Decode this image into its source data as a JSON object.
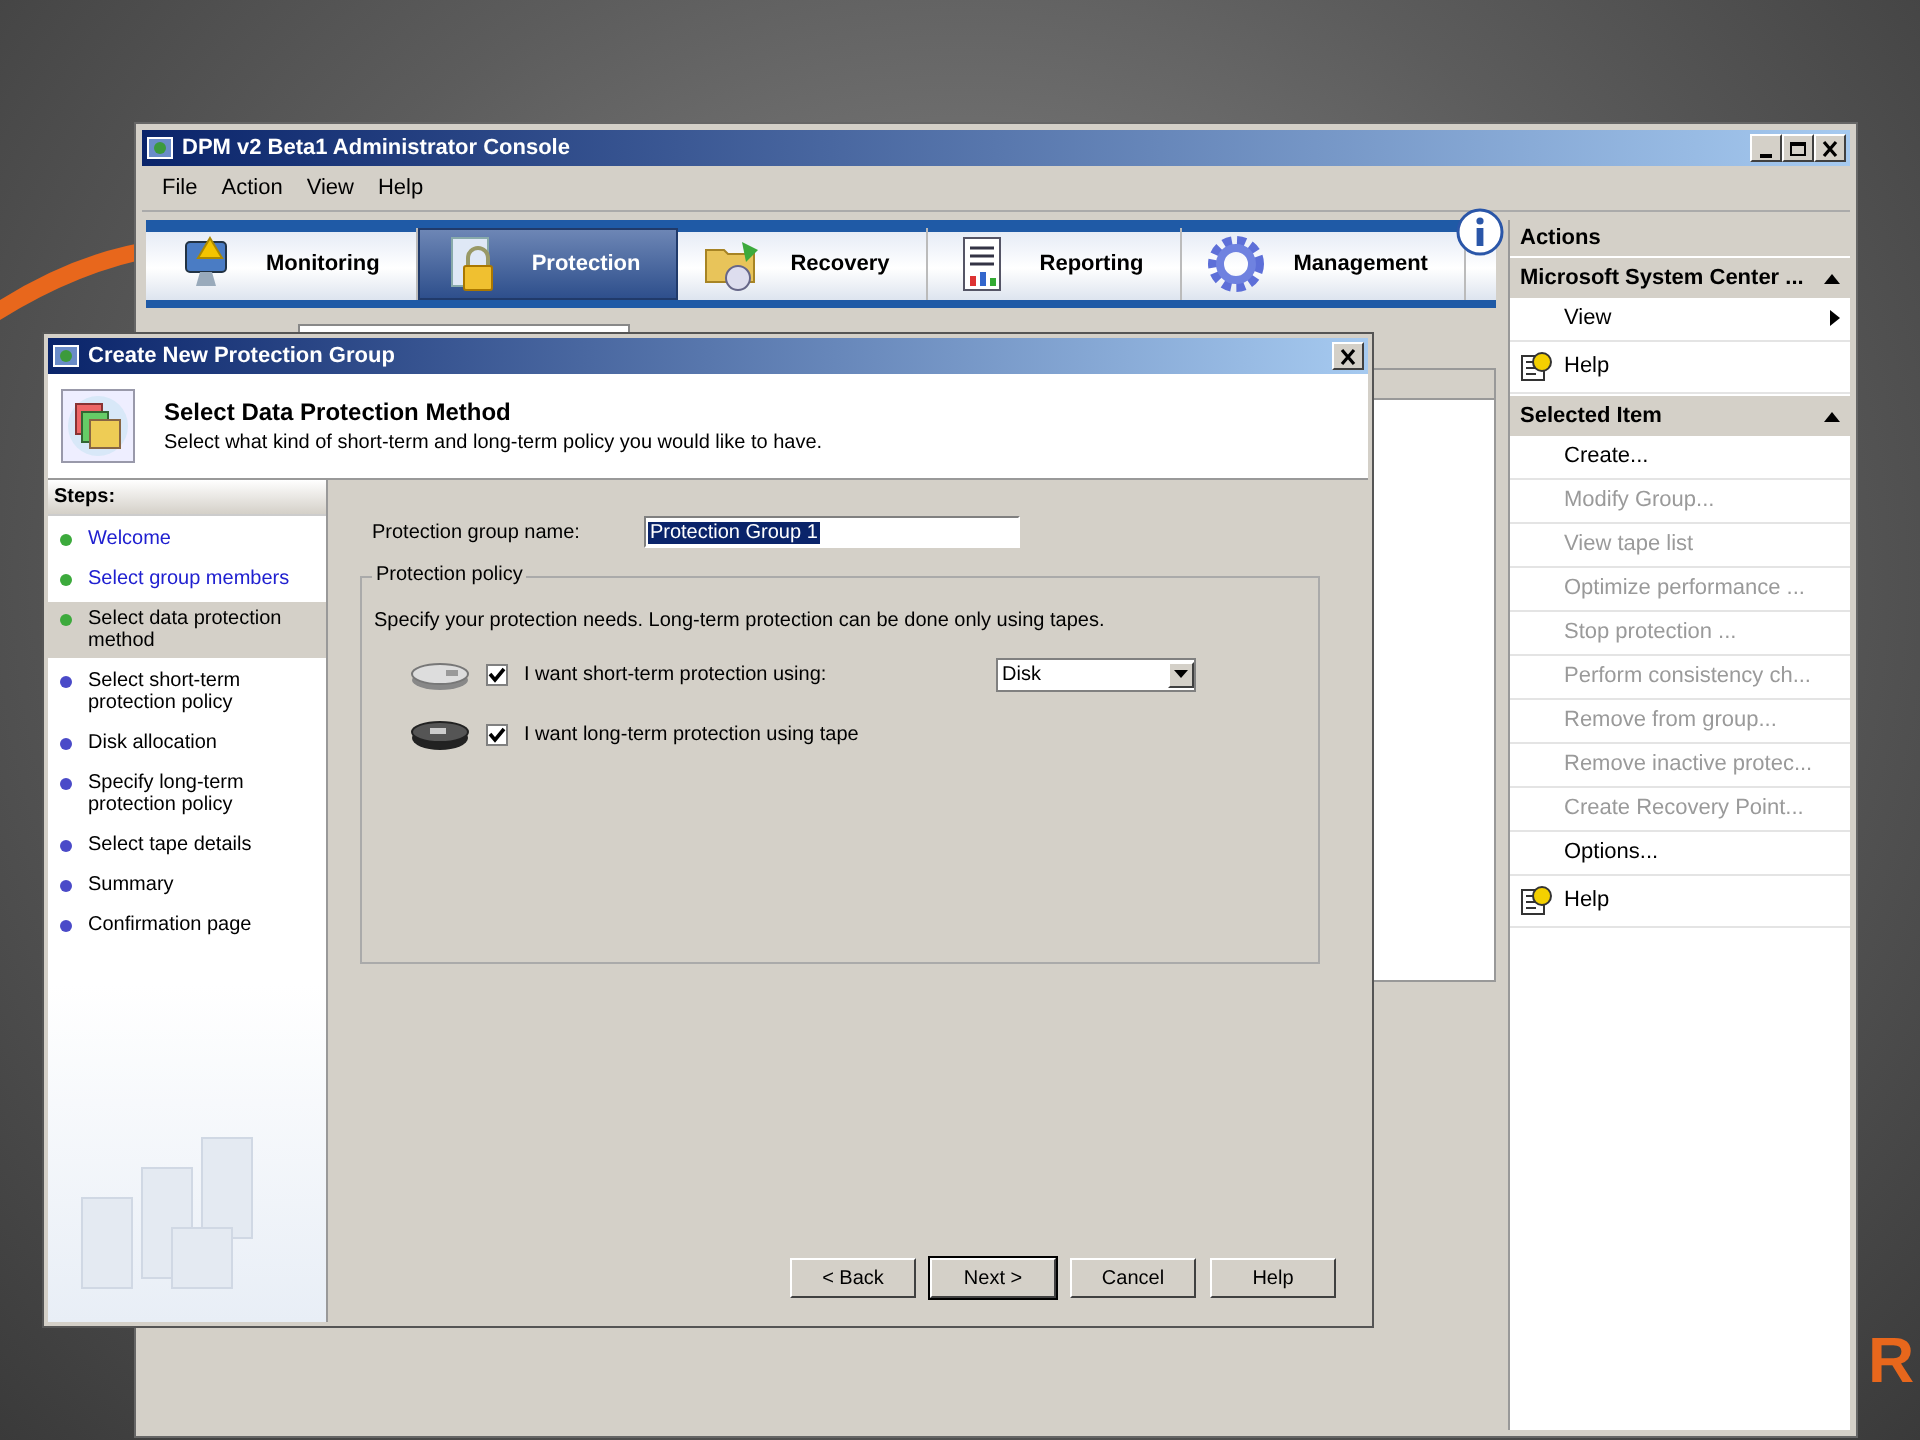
{
  "console": {
    "title": "DPM v2 Beta1 Administrator Console",
    "menu": [
      "File",
      "Action",
      "View",
      "Help"
    ],
    "tabs": [
      {
        "label": "Monitoring",
        "selected": false
      },
      {
        "label": "Protection",
        "selected": true
      },
      {
        "label": "Recovery",
        "selected": false
      },
      {
        "label": "Reporting",
        "selected": false
      },
      {
        "label": "Management",
        "selected": false
      }
    ],
    "actions": {
      "title": "Actions",
      "sections": [
        {
          "title": "Microsoft System Center ...",
          "expanded": true,
          "items": [
            {
              "label": "View",
              "kind": "submenu",
              "disabled": false
            },
            {
              "label": "Help",
              "kind": "help",
              "disabled": false
            }
          ]
        },
        {
          "title": "Selected Item",
          "expanded": true,
          "items": [
            {
              "label": "Create...",
              "kind": "plain",
              "disabled": false
            },
            {
              "label": "Modify Group...",
              "kind": "plain",
              "disabled": true
            },
            {
              "label": "View tape list",
              "kind": "plain",
              "disabled": true
            },
            {
              "label": "Optimize performance ...",
              "kind": "plain",
              "disabled": true
            },
            {
              "label": "Stop protection ...",
              "kind": "plain",
              "disabled": true
            },
            {
              "label": "Perform consistency ch...",
              "kind": "plain",
              "disabled": true
            },
            {
              "label": "Remove from group...",
              "kind": "plain",
              "disabled": true
            },
            {
              "label": "Remove inactive protec...",
              "kind": "plain",
              "disabled": true
            },
            {
              "label": "Create Recovery Point...",
              "kind": "plain",
              "disabled": true
            },
            {
              "label": "Options...",
              "kind": "plain",
              "disabled": false
            },
            {
              "label": "Help",
              "kind": "help",
              "disabled": false
            }
          ]
        }
      ]
    }
  },
  "dialog": {
    "title": "Create New Protection Group",
    "heading": "Select Data Protection Method",
    "subheading": "Select what kind of short-term and long-term policy you would like to have.",
    "steps_title": "Steps:",
    "steps": [
      {
        "label": "Welcome",
        "completed": true,
        "selected": false
      },
      {
        "label": "Select group members",
        "completed": true,
        "selected": false
      },
      {
        "label": "Select data protection method",
        "completed": true,
        "selected": true
      },
      {
        "label": "Select short-term protection policy",
        "completed": false,
        "selected": false
      },
      {
        "label": "Disk allocation",
        "completed": false,
        "selected": false
      },
      {
        "label": "Specify long-term protection policy",
        "completed": false,
        "selected": false
      },
      {
        "label": "Select tape details",
        "completed": false,
        "selected": false
      },
      {
        "label": "Summary",
        "completed": false,
        "selected": false
      },
      {
        "label": "Confirmation page",
        "completed": false,
        "selected": false
      }
    ],
    "name_label": "Protection group name:",
    "name_value": "Protection Group 1",
    "policy": {
      "title": "Protection policy",
      "text": "Specify your protection needs. Long-term protection can be done only using tapes.",
      "options": [
        {
          "label": "I want short-term protection using:",
          "checked": true,
          "dropdown": "Disk"
        },
        {
          "label": "I want long-term protection using tape",
          "checked": true
        }
      ]
    },
    "buttons": [
      {
        "label": "< Back",
        "default": false
      },
      {
        "label": "Next >",
        "default": true
      },
      {
        "label": "Cancel",
        "default": false
      },
      {
        "label": "Help",
        "default": false
      }
    ]
  },
  "slide_logo": "R"
}
